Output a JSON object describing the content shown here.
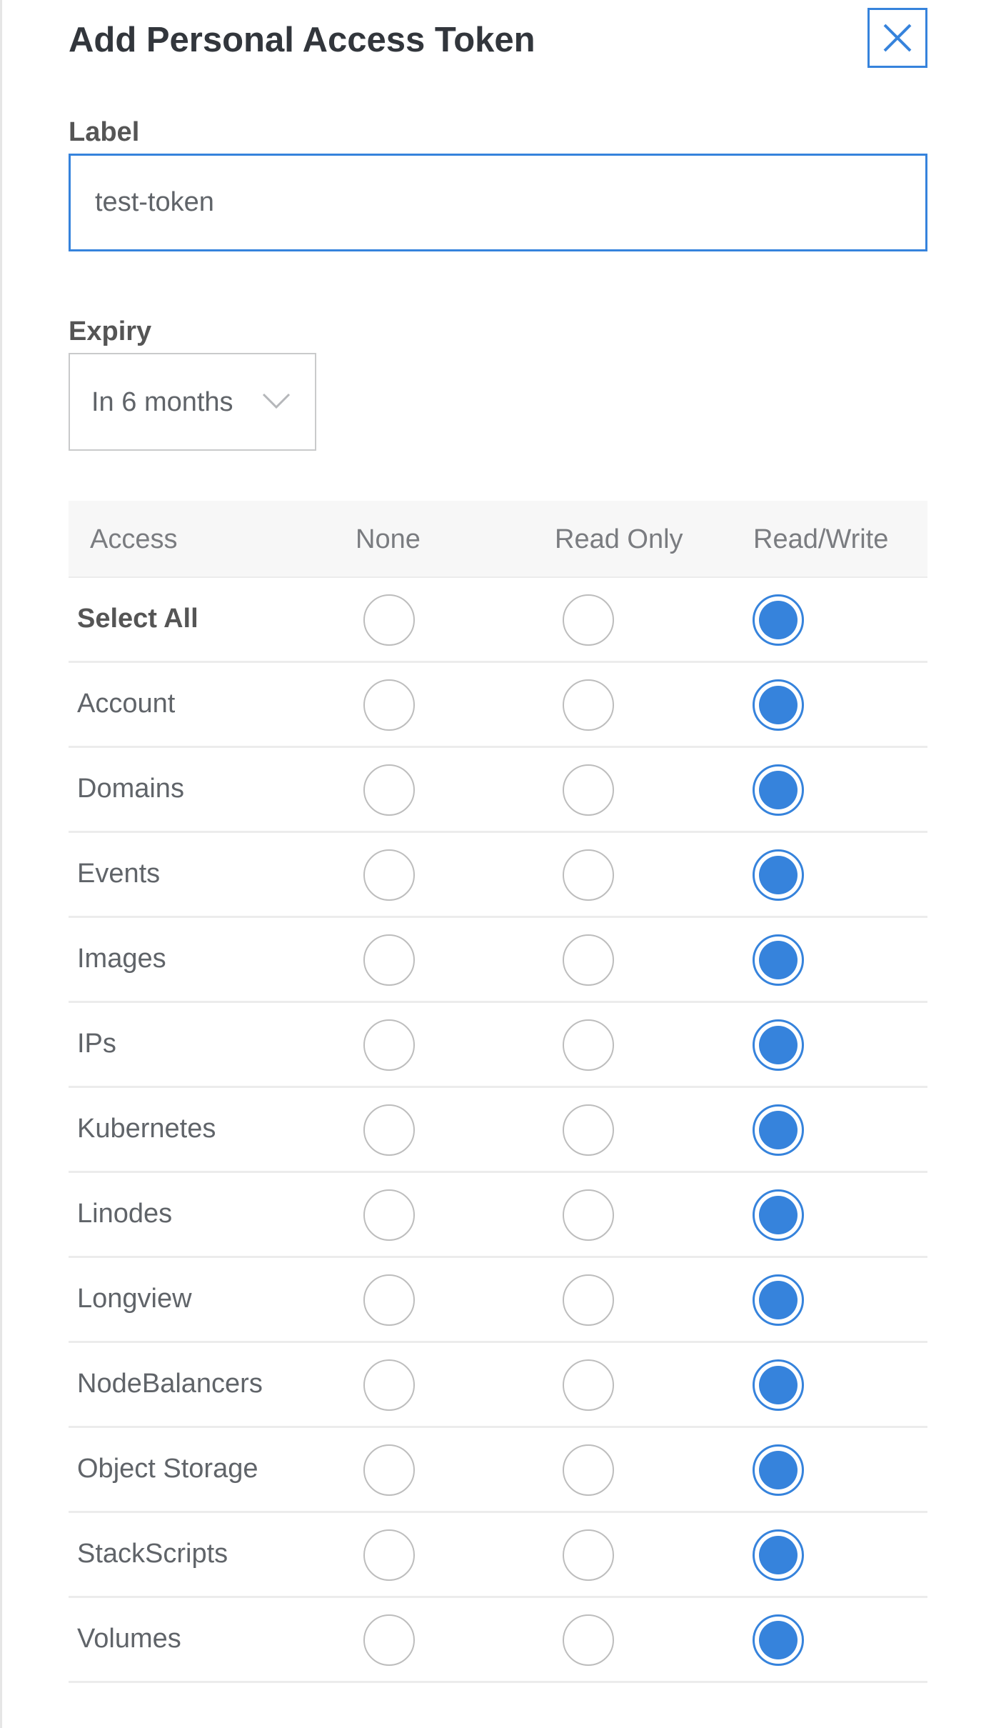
{
  "dialog": {
    "title": "Add Personal Access Token",
    "close_icon": "close-icon"
  },
  "label_field": {
    "label": "Label",
    "value": "test-token"
  },
  "expiry_field": {
    "label": "Expiry",
    "selected": "In 6 months",
    "chevron_icon": "chevron-down-icon"
  },
  "access_table": {
    "headers": {
      "access": "Access",
      "none": "None",
      "read_only": "Read Only",
      "read_write": "Read/Write"
    },
    "rows": [
      {
        "label": "Select All",
        "selected": "read_write"
      },
      {
        "label": "Account",
        "selected": "read_write"
      },
      {
        "label": "Domains",
        "selected": "read_write"
      },
      {
        "label": "Events",
        "selected": "read_write"
      },
      {
        "label": "Images",
        "selected": "read_write"
      },
      {
        "label": "IPs",
        "selected": "read_write"
      },
      {
        "label": "Kubernetes",
        "selected": "read_write"
      },
      {
        "label": "Linodes",
        "selected": "read_write"
      },
      {
        "label": "Longview",
        "selected": "read_write"
      },
      {
        "label": "NodeBalancers",
        "selected": "read_write"
      },
      {
        "label": "Object Storage",
        "selected": "read_write"
      },
      {
        "label": "StackScripts",
        "selected": "read_write"
      },
      {
        "label": "Volumes",
        "selected": "read_write"
      }
    ]
  },
  "colors": {
    "accent": "#3683dc",
    "title_text": "#32363c",
    "body_text": "#606469",
    "header_bg": "#f7f7f7",
    "divider": "#ececec"
  }
}
